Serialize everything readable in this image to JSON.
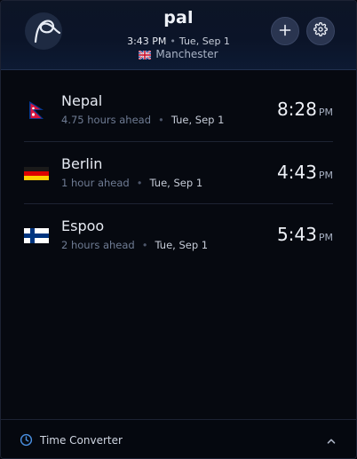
{
  "header": {
    "title": "pal",
    "time": "3:43 PM",
    "date": "Tue, Sep 1",
    "location": "Manchester",
    "location_flag": "uk-flag-icon"
  },
  "actions": {
    "add_icon": "plus-icon",
    "settings_icon": "gear-icon"
  },
  "clocks": [
    {
      "name": "Nepal",
      "offset": "4.75 hours ahead",
      "date": "Tue, Sep 1",
      "time": "8:28",
      "ampm": "PM",
      "flag": "nepal-flag-icon"
    },
    {
      "name": "Berlin",
      "offset": "1 hour ahead",
      "date": "Tue, Sep 1",
      "time": "4:43",
      "ampm": "PM",
      "flag": "germany-flag-icon"
    },
    {
      "name": "Espoo",
      "offset": "2 hours ahead",
      "date": "Tue, Sep 1",
      "time": "5:43",
      "ampm": "PM",
      "flag": "finland-flag-icon"
    }
  ],
  "footer": {
    "label": "Time Converter",
    "icon": "clock-icon",
    "toggle_icon": "chevron-up-icon"
  },
  "colors": {
    "background": "#060910",
    "header": "#0b1428",
    "accent": "#4a90e2",
    "button": "#2a3550"
  }
}
